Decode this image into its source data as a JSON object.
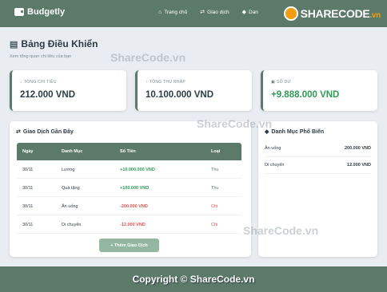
{
  "nav": {
    "brand": "Budgetly",
    "links": [
      {
        "label": "Trang chủ",
        "icon": "home-icon",
        "glyph": "⌂"
      },
      {
        "label": "Giao dịch",
        "icon": "exchange-icon",
        "glyph": "⇄"
      },
      {
        "label": "Dan",
        "icon": "tag-icon",
        "glyph": "◆"
      }
    ],
    "logo_text": "SHARECODE",
    "logo_suffix": ".vn"
  },
  "header": {
    "title": "Bảng Điều Khiển",
    "title_icon": "chart-icon",
    "subtitle": "Xem tổng quan chi tiêu của bạn"
  },
  "stats": [
    {
      "label": "TỔNG CHI TIÊU",
      "icon": "arrow-down-icon",
      "value": "212.000 VND"
    },
    {
      "label": "TỔNG THU NHẬP",
      "icon": "arrow-up-icon",
      "value": "10.100.000 VND"
    },
    {
      "label": "SỐ DƯ",
      "icon": "wallet-icon",
      "value": "+9.888.000 VND"
    }
  ],
  "transactions": {
    "title": "Giao Dịch Gần Đây",
    "icon": "exchange-icon",
    "columns": [
      "Ngày",
      "Danh Mục",
      "Số Tiền",
      "Loại"
    ],
    "rows": [
      {
        "date": "30/11",
        "category": "Lương",
        "amount": "+10.000.000 VND",
        "type": "Thu"
      },
      {
        "date": "30/11",
        "category": "Quà tặng",
        "amount": "+100.000 VND",
        "type": "Thu"
      },
      {
        "date": "30/11",
        "category": "Ăn uống",
        "amount": "-200.000 VND",
        "type": "Chi"
      },
      {
        "date": "30/11",
        "category": "Di chuyển",
        "amount": "-12.000 VND",
        "type": "Chi"
      }
    ],
    "add_button": "+ Thêm Giao Dịch"
  },
  "popular": {
    "title": "Danh Mục Phổ Biến",
    "icon": "tag-icon",
    "items": [
      {
        "name": "Ăn uống",
        "amount": "200.000 VND"
      },
      {
        "name": "Di chuyển",
        "amount": "12.000 VND"
      }
    ]
  },
  "footer": {
    "copyright": "Copyright © ShareCode.vn"
  },
  "watermark": "ShareCode.vn",
  "colors": {
    "primary": "#5c7a69",
    "income": "#2e9b57",
    "expense": "#d9534f"
  }
}
